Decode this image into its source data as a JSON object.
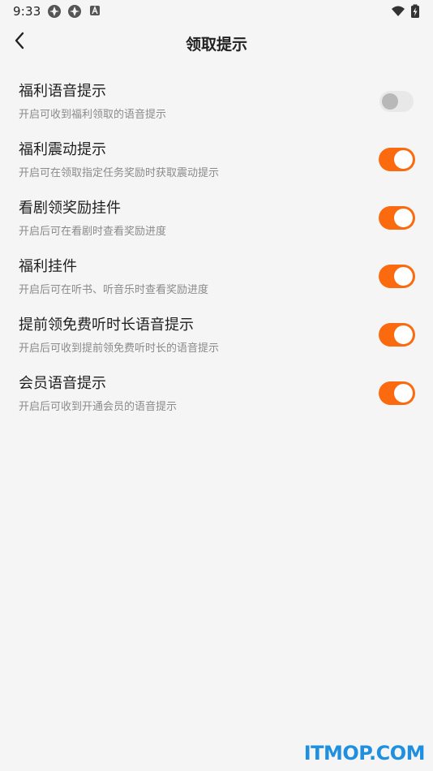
{
  "status_bar": {
    "time": "9:33",
    "icons": [
      "app-notification-icon",
      "app-notification-icon",
      "font-a-icon",
      "wifi-icon",
      "battery-charging-icon"
    ]
  },
  "header": {
    "back_icon": "chevron-left-icon",
    "title": "领取提示"
  },
  "settings": [
    {
      "title": "福利语音提示",
      "description": "开启可收到福利领取的语音提示",
      "enabled": false
    },
    {
      "title": "福利震动提示",
      "description": "开启可在领取指定任务奖励时获取震动提示",
      "enabled": true
    },
    {
      "title": "看剧领奖励挂件",
      "description": "开启后可在看剧时查看奖励进度",
      "enabled": true
    },
    {
      "title": "福利挂件",
      "description": "开启后可在听书、听音乐时查看奖励进度",
      "enabled": true
    },
    {
      "title": "提前领免费听时长语音提示",
      "description": "开启后可收到提前领免费听时长的语音提示",
      "enabled": true
    },
    {
      "title": "会员语音提示",
      "description": "开启后可收到开通会员的语音提示",
      "enabled": true
    }
  ],
  "colors": {
    "accent": "#fb6a0f",
    "toggle_off_track": "#e8e8e8",
    "toggle_off_knob": "#b8b8b8",
    "background": "#f5f5f5",
    "watermark": "#1f8fe0"
  },
  "watermark": "ITMOP.COM"
}
